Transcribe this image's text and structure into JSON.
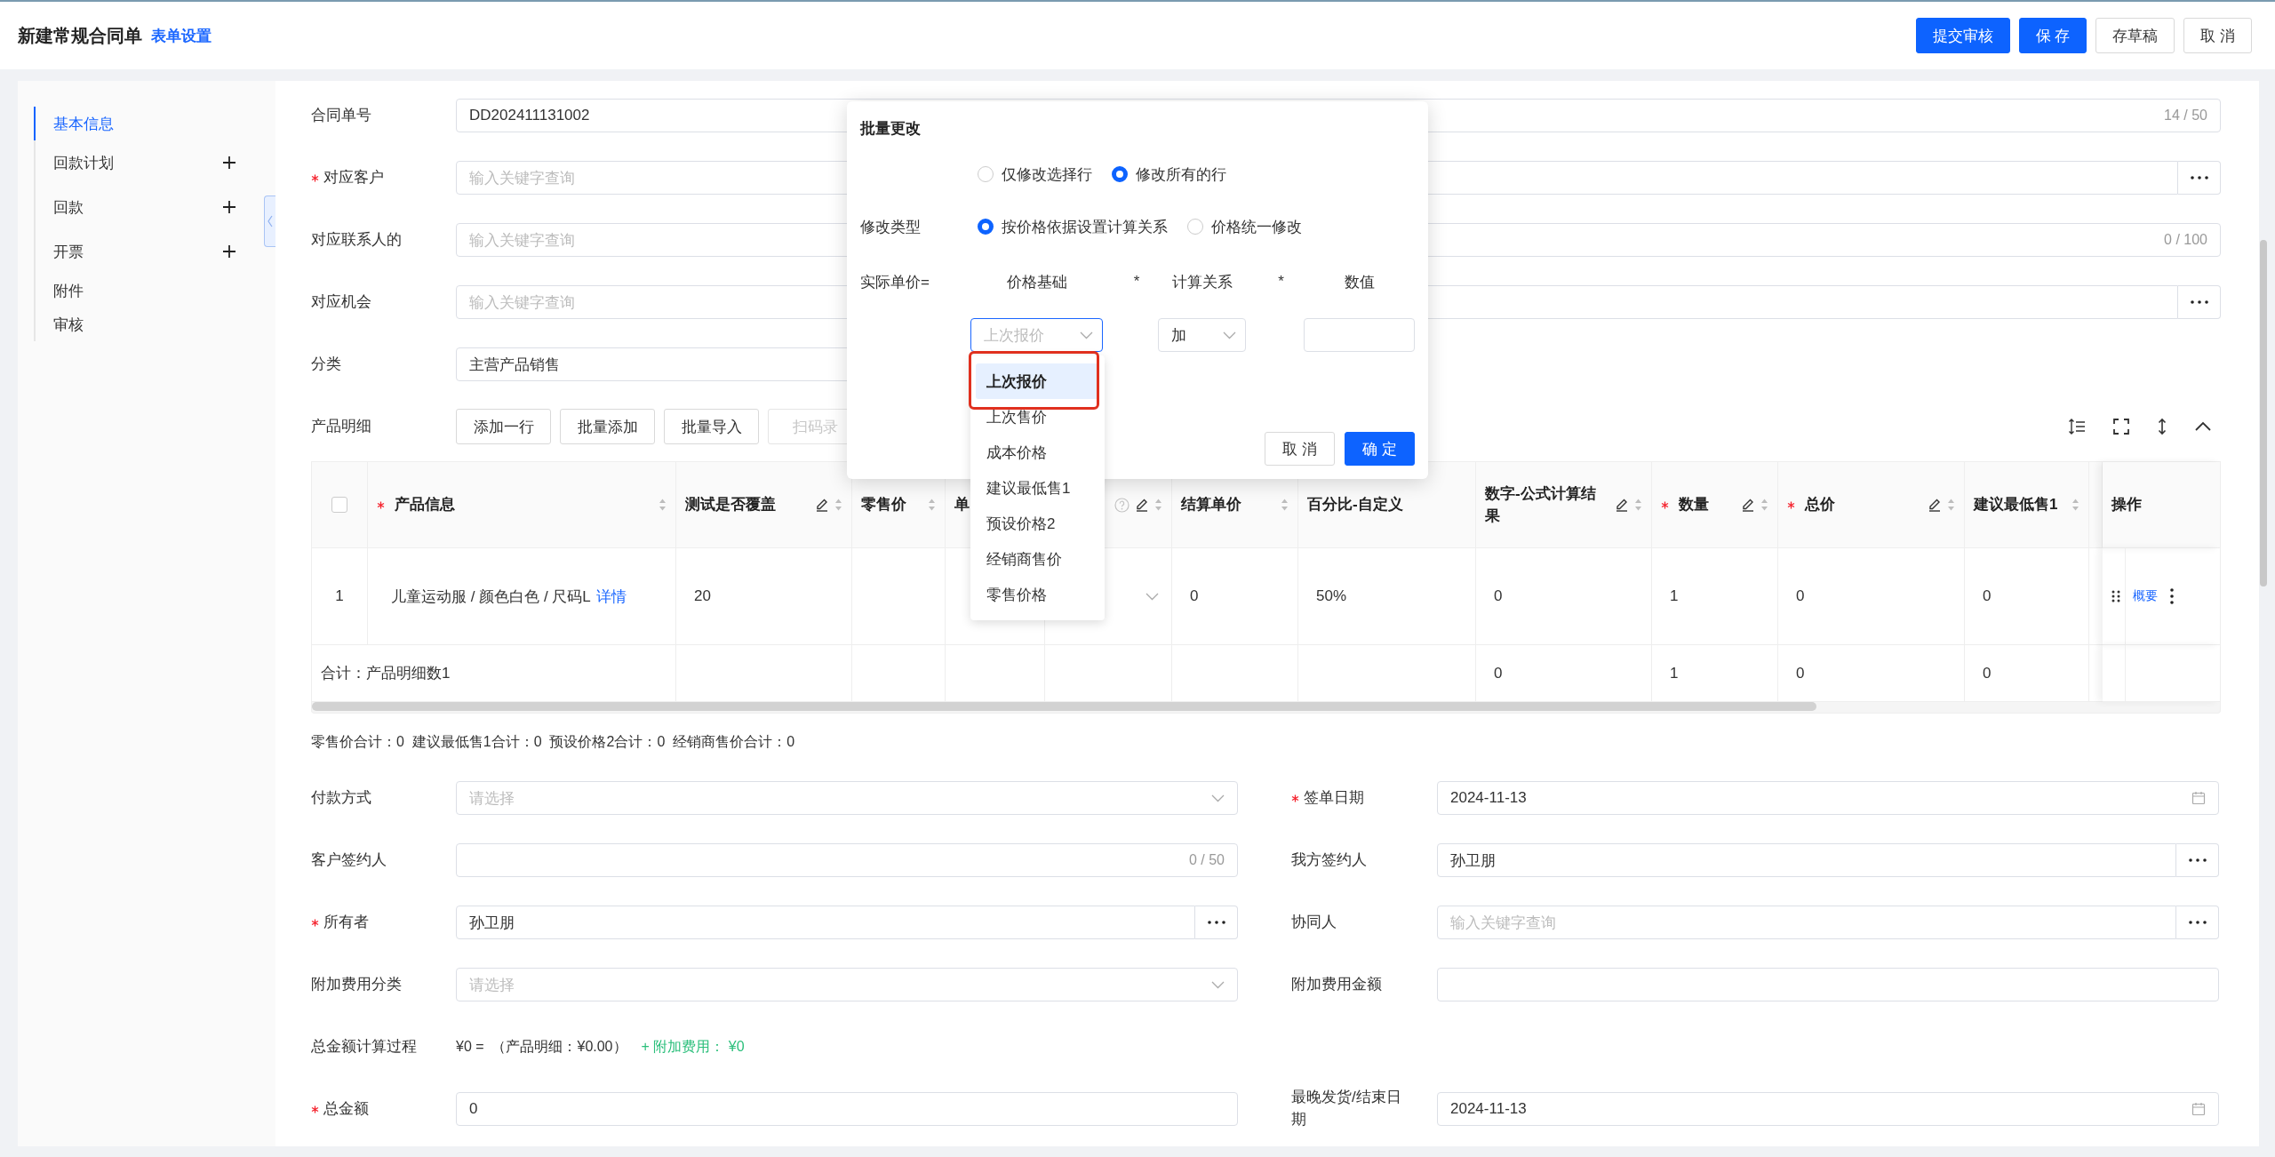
{
  "header": {
    "title": "新建常规合同单",
    "link": "表单设置",
    "buttons": [
      {
        "label": "提交审核",
        "primary": true
      },
      {
        "label": "保 存",
        "primary": true
      },
      {
        "label": "存草稿",
        "primary": false
      },
      {
        "label": "取 消",
        "primary": false
      }
    ]
  },
  "sidebar": {
    "items": [
      {
        "label": "基本信息",
        "selected": true,
        "addable": false
      },
      {
        "label": "回款计划",
        "selected": false,
        "addable": true
      },
      {
        "label": "回款",
        "selected": false,
        "addable": true
      },
      {
        "label": "开票",
        "selected": false,
        "addable": true
      },
      {
        "label": "附件",
        "selected": false,
        "addable": false
      },
      {
        "label": "审核",
        "selected": false,
        "addable": false
      }
    ]
  },
  "basic_fields": [
    {
      "label": "合同单号",
      "required": false,
      "kind": "text",
      "value": "DD202411131002",
      "counter": "14 / 50"
    },
    {
      "label": "对应客户",
      "required": true,
      "kind": "lookup",
      "placeholder": "输入关键字查询"
    },
    {
      "label": "对应联系人的",
      "required": false,
      "kind": "text",
      "placeholder": "输入关键字查询",
      "counter": "0 / 100"
    },
    {
      "label": "对应机会",
      "required": false,
      "kind": "lookup",
      "placeholder": "输入关键字查询"
    },
    {
      "label": "分类",
      "required": false,
      "kind": "plain",
      "value": "主营产品销售"
    }
  ],
  "products": {
    "label": "产品明细",
    "actions": [
      {
        "label": "添加一行",
        "disabled": false
      },
      {
        "label": "批量添加",
        "disabled": false
      },
      {
        "label": "批量导入",
        "disabled": false
      },
      {
        "label": "扫码录",
        "disabled": true
      }
    ],
    "columns": [
      {
        "kind": "checkbox",
        "checked": false
      },
      {
        "kind": "data",
        "label": "产品信息",
        "required": true,
        "editable": false,
        "sortable": true,
        "help": false
      },
      {
        "kind": "data",
        "label": "测试是否覆盖",
        "required": false,
        "editable": true,
        "sortable": true,
        "help": false
      },
      {
        "kind": "data",
        "label": "零售价",
        "required": false,
        "editable": false,
        "sortable": true,
        "help": false
      },
      {
        "kind": "data",
        "label": "单",
        "required": false,
        "editable": false,
        "sortable": false,
        "help": false
      },
      {
        "kind": "data",
        "required": false,
        "editable": true,
        "sortable": true,
        "help": true
      },
      {
        "kind": "data",
        "label": "结算单价",
        "required": false,
        "editable": false,
        "sortable": true,
        "help": false
      },
      {
        "kind": "data",
        "label": "百分比-自定义",
        "required": false,
        "editable": false,
        "sortable": false,
        "help": false
      },
      {
        "kind": "data",
        "label": "数字-公式计算结果",
        "required": false,
        "editable": true,
        "sortable": true,
        "help": false
      },
      {
        "kind": "data",
        "label": "数量",
        "required": true,
        "editable": true,
        "sortable": true,
        "help": false
      },
      {
        "kind": "data",
        "label": "总价",
        "required": true,
        "editable": true,
        "sortable": true,
        "help": false
      },
      {
        "kind": "data",
        "label": "建议最低售1",
        "required": false,
        "editable": false,
        "sortable": true,
        "help": false
      },
      {
        "kind": "data",
        "required": false,
        "editable": false,
        "sortable": false,
        "help": false
      },
      {
        "kind": "actions",
        "label": "操作"
      }
    ],
    "rows": [
      {
        "cells": [
          {
            "kind": "index",
            "value": "1"
          },
          {
            "kind": "product",
            "value": "儿童运动服 / 颜色白色 / 尺码L",
            "link": "详情"
          },
          {
            "kind": "text",
            "value": "20"
          },
          {
            "kind": "text"
          },
          {
            "kind": "text"
          },
          {
            "kind": "select"
          },
          {
            "kind": "text",
            "value": "0"
          },
          {
            "kind": "text",
            "value": "50%"
          },
          {
            "kind": "text",
            "value": "0"
          },
          {
            "kind": "text",
            "value": "1"
          },
          {
            "kind": "text",
            "value": "0"
          },
          {
            "kind": "text",
            "value": "0"
          },
          {
            "kind": "text"
          },
          {
            "kind": "actions",
            "link": "概要"
          }
        ]
      }
    ],
    "total": {
      "cells": [
        {
          "kind": "text",
          "value": "合计：产品明细数1",
          "colspan": 2
        },
        {
          "kind": "text"
        },
        {
          "kind": "text"
        },
        {
          "kind": "text"
        },
        {
          "kind": "text"
        },
        {
          "kind": "text"
        },
        {
          "kind": "text"
        },
        {
          "kind": "text",
          "value": "0"
        },
        {
          "kind": "text",
          "value": "1"
        },
        {
          "kind": "text",
          "value": "0"
        },
        {
          "kind": "text",
          "value": "0"
        },
        {
          "kind": "text"
        },
        {
          "kind": "actions"
        }
      ]
    },
    "summary": "零售价合计：0  建议最低售1合计：0  预设价格2合计：0  经销商售价合计：0"
  },
  "detail_fields": [
    {
      "left": {
        "label": "付款方式",
        "required": false,
        "kind": "select",
        "placeholder": "请选择"
      },
      "right": {
        "label": "签单日期",
        "required": true,
        "kind": "date",
        "value": "2024-11-13"
      }
    },
    {
      "left": {
        "label": "客户签约人",
        "required": false,
        "kind": "text",
        "counter": "0 / 50"
      },
      "right": {
        "label": "我方签约人",
        "required": false,
        "kind": "lookup",
        "value": "孙卫朋"
      }
    },
    {
      "left": {
        "label": "所有者",
        "required": true,
        "kind": "lookup",
        "value": "孙卫朋"
      },
      "right": {
        "label": "协同人",
        "required": false,
        "kind": "lookup",
        "placeholder": "输入关键字查询"
      }
    },
    {
      "left": {
        "label": "附加费用分类",
        "required": false,
        "kind": "select",
        "placeholder": "请选择"
      },
      "right": {
        "label": "附加费用金额",
        "required": false,
        "kind": "text"
      }
    },
    {
      "left": {
        "label": "总金额计算过程",
        "required": false,
        "kind": "formula",
        "parts": [
          {
            "text": "¥0 =  （产品明细：¥0.00）",
            "color": "#333333"
          },
          {
            "text": "+ 附加费用： ¥0",
            "color": "#2bbf7b"
          }
        ]
      }
    },
    {
      "left": {
        "label": "总金额",
        "required": true,
        "kind": "text",
        "value": "0"
      },
      "right": {
        "label": "最晚发货/结束日期",
        "required": false,
        "kind": "date",
        "value": "2024-11-13"
      }
    }
  ],
  "batch_edit": {
    "title": "批量更改",
    "scope_options": [
      {
        "label": "仅修改选择行",
        "selected": false
      },
      {
        "label": "修改所有的行",
        "selected": true
      }
    ],
    "type_label": "修改类型",
    "type_options": [
      {
        "label": "按价格依据设置计算关系",
        "selected": true
      },
      {
        "label": "价格统一修改",
        "selected": false
      }
    ],
    "formula_label": "实际单价=",
    "headers": [
      "价格基础",
      "*",
      "计算关系",
      "*",
      "数值"
    ],
    "base_select": {
      "placeholder": "上次报价",
      "focused": true
    },
    "relation_select": {
      "value": "加"
    },
    "buttons": [
      {
        "label": "取 消",
        "primary": false
      },
      {
        "label": "确 定",
        "primary": true
      }
    ],
    "dropdown": {
      "options": [
        {
          "label": "上次报价",
          "selected": true,
          "annotated": true
        },
        {
          "label": "上次售价",
          "selected": false,
          "annotated": false
        },
        {
          "label": "成本价格",
          "selected": false,
          "annotated": false
        },
        {
          "label": "建议最低售1",
          "selected": false,
          "annotated": false
        },
        {
          "label": "预设价格2",
          "selected": false,
          "annotated": false
        },
        {
          "label": "经销商售价",
          "selected": false,
          "annotated": false
        },
        {
          "label": "零售价格",
          "selected": false,
          "annotated": false
        }
      ]
    }
  }
}
